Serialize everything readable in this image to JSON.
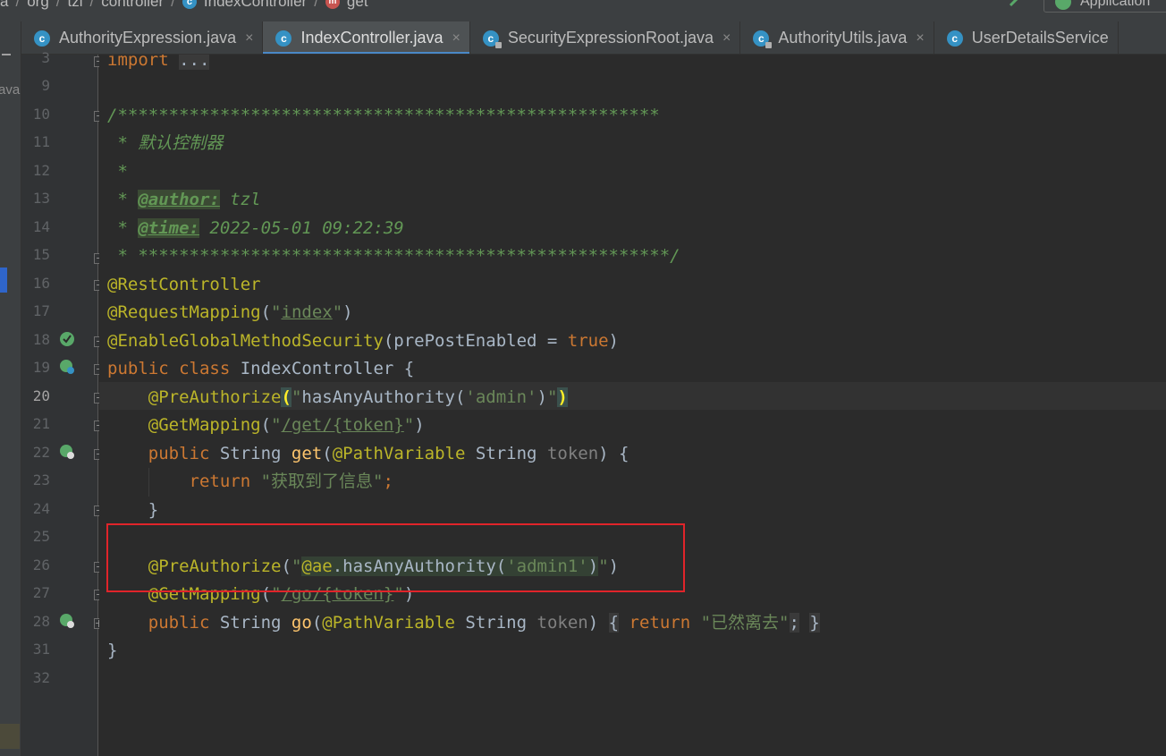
{
  "breadcrumb": {
    "items": [
      "a",
      "org",
      "tzl",
      "controller",
      "IndexController",
      "get"
    ],
    "run_config": "Application"
  },
  "left_strip": {
    "label": "ava"
  },
  "tabs": [
    {
      "label": "AuthorityExpression.java",
      "icon": "class-icon",
      "active": false,
      "close": "×"
    },
    {
      "label": "IndexController.java",
      "icon": "class-icon",
      "active": true,
      "close": "×"
    },
    {
      "label": "SecurityExpressionRoot.java",
      "icon": "class-locked-icon",
      "active": false,
      "close": "×"
    },
    {
      "label": "AuthorityUtils.java",
      "icon": "class-locked-icon",
      "active": false,
      "close": "×"
    },
    {
      "label": "UserDetailsService",
      "icon": "interface-icon",
      "active": false,
      "close": ""
    }
  ],
  "gutter": {
    "line_numbers": [
      "3",
      "9",
      "10",
      "11",
      "12",
      "13",
      "14",
      "15",
      "16",
      "17",
      "18",
      "19",
      "20",
      "21",
      "22",
      "23",
      "24",
      "25",
      "26",
      "27",
      "28",
      "31",
      "32"
    ],
    "current_line": "20"
  },
  "code": {
    "l3_import": "import",
    "l3_fold": "...",
    "l10": "/*****************************************************",
    "l11": " * 默认控制器",
    "l12": " *",
    "l13_star": " * ",
    "l13_tag": "@author:",
    "l13_val": " tzl",
    "l14_star": " * ",
    "l14_tag": "@time:",
    "l14_val": " 2022-05-01 09:22:39",
    "l15": " * ****************************************************/",
    "l16": "@RestController",
    "l17_ann": "@RequestMapping",
    "l17_open": "(",
    "l17_q1": "\"",
    "l17_val": "index",
    "l17_q2": "\"",
    "l17_close": ")",
    "l18_ann": "@EnableGlobalMethodSecurity",
    "l18_args": "(prePostEnabled = ",
    "l18_true": "true",
    "l18_close": ")",
    "l19_pub": "public",
    "l19_class": "class",
    "l19_name": " IndexController {",
    "l20_ann": "@PreAuthorize",
    "l20_open": "(",
    "l20_str1": "\"",
    "l20_expr1": "hasAnyAuthority(",
    "l20_lit": "'admin'",
    "l20_expr2": ")",
    "l20_str2": "\"",
    "l20_close": ")",
    "l21_ann": "@GetMapping",
    "l21_open": "(",
    "l21_q1": "\"",
    "l21_path": "/get/{token}",
    "l21_q2": "\"",
    "l21_close": ")",
    "l22_pub": "public",
    "l22_type": " String ",
    "l22_fn": "get",
    "l22_open": "(",
    "l22_ann": "@PathVariable",
    "l22_type2": " String ",
    "l22_param": "token",
    "l22_close": ") {",
    "l23_ret": "return",
    "l23_str": "\"获取到了信息\"",
    "l23_semi": ";",
    "l24": "}",
    "l26_ann": "@PreAuthorize",
    "l26_open": "(",
    "l26_q1": "\"",
    "l26_ref": "@ae",
    "l26_dot": ".",
    "l26_call": "hasAnyAuthority",
    "l26_p1": "(",
    "l26_lit": "'admin1'",
    "l26_p2": ")",
    "l26_q2": "\"",
    "l26_close": ")",
    "l27_ann": "@GetMapping",
    "l27_open": "(",
    "l27_q1": "\"",
    "l27_path": "/go/{token}",
    "l27_q2": "\"",
    "l27_close": ")",
    "l28_pub": "public",
    "l28_type": " String ",
    "l28_fn": "go",
    "l28_open": "(",
    "l28_ann": "@PathVariable",
    "l28_type2": " String ",
    "l28_param": "token",
    "l28_close": ")",
    "l28_lb": "{",
    "l28_ret": "return",
    "l28_str": "\"已然离去\"",
    "l28_semi": ";",
    "l28_rb": "}",
    "l31": "}"
  },
  "colors": {
    "keyword": "#cc7832",
    "annotation": "#bbb529",
    "string": "#6a8759",
    "doc_comment": "#629755",
    "method": "#ffc66d",
    "highlight_box": "#e0242a"
  }
}
